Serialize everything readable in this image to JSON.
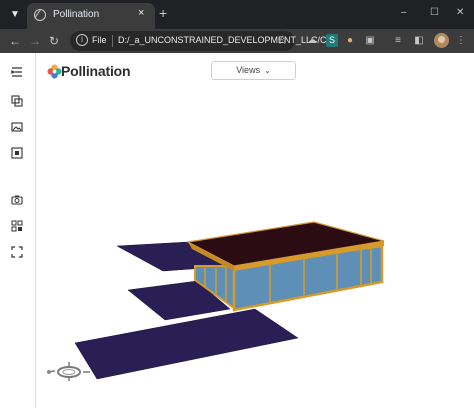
{
  "browser": {
    "tab_title": "Pollination",
    "tab_close": "×",
    "new_tab": "+",
    "window_controls": {
      "minimize": "–",
      "maximize": "☐",
      "close": "✕"
    },
    "omnibox": {
      "scheme": "File",
      "url": "D:/_a_UNCONSTRAINED_DEVELOPMENT_LLC/C..."
    }
  },
  "app": {
    "brand_name": "Pollination",
    "views_button": {
      "label": "Views",
      "chevron": "⌄"
    },
    "sidebar_top": [
      "menu-icon",
      "layers-icon",
      "image-icon",
      "select-box-icon"
    ],
    "sidebar_bottom": [
      "camera-icon",
      "sections-icon",
      "fullscreen-icon"
    ]
  },
  "colors": {
    "roof": "#2b0c12",
    "floor_slab": "#2a1f55",
    "glass": "#5e8fb7",
    "frame": "#d69a2d",
    "brand_blue": "#3f7fd8",
    "brand_orange": "#f0a93a",
    "brand_teal": "#27b39a",
    "brand_red": "#e3574b"
  }
}
